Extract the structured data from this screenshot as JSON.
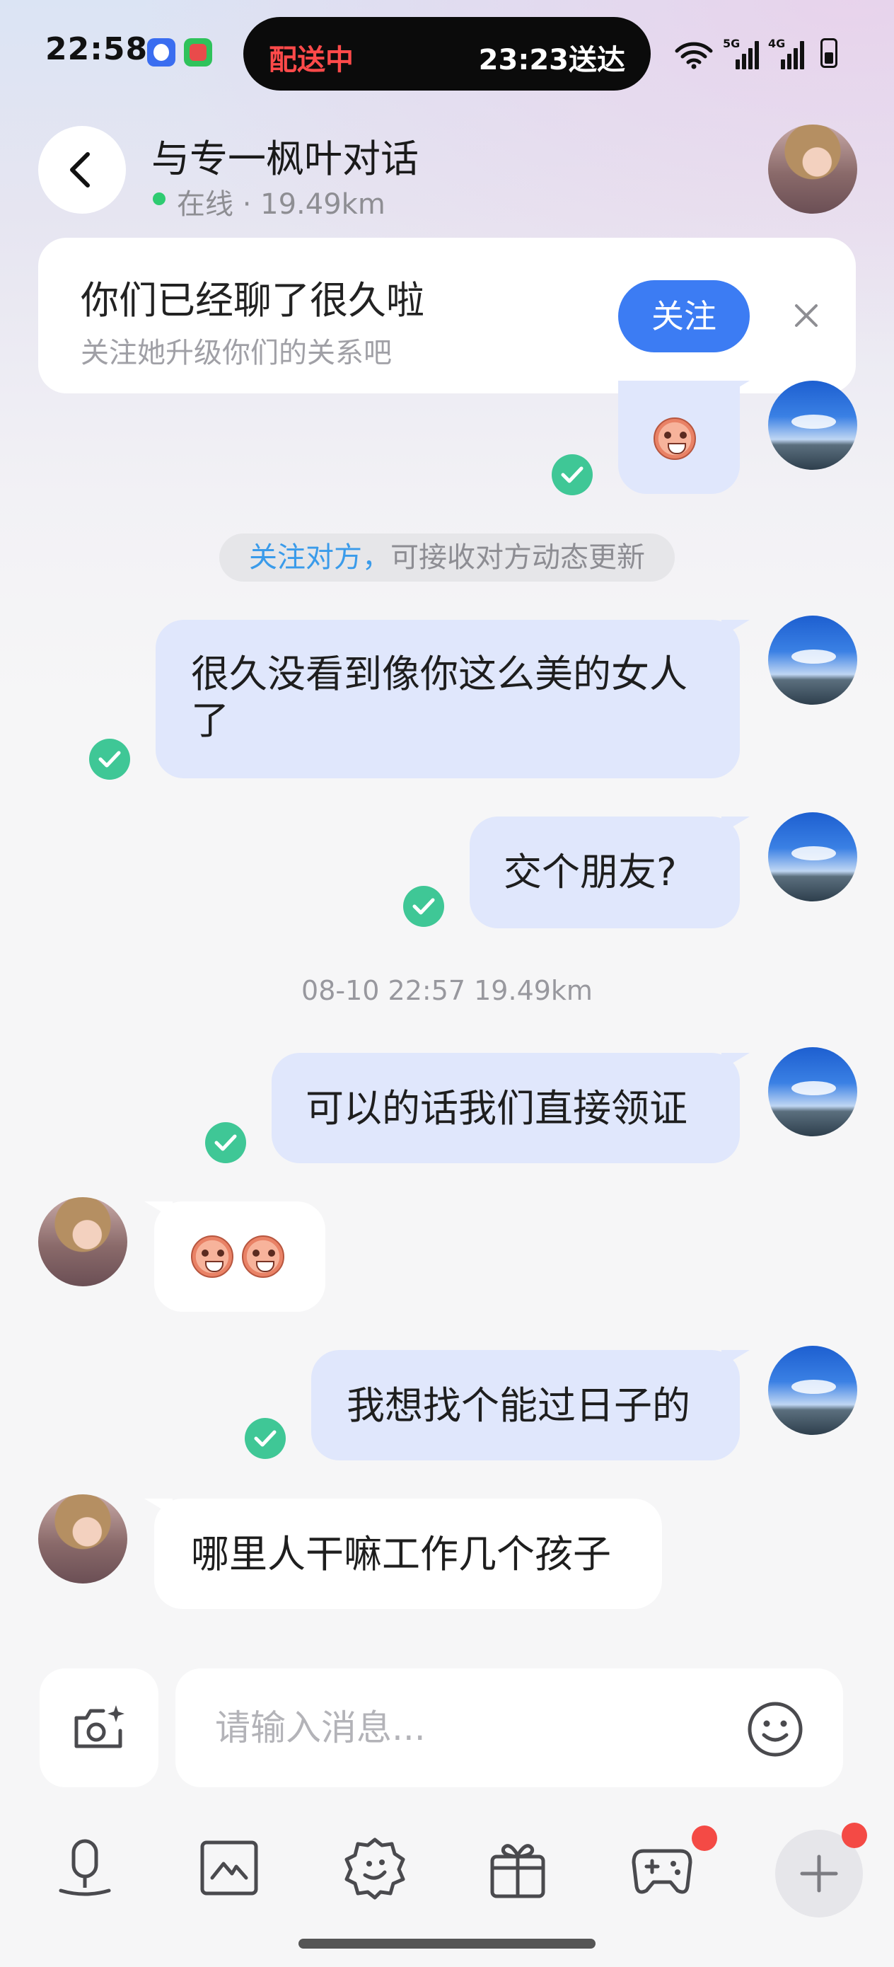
{
  "status_bar": {
    "time": "22:58",
    "delivery_status": "配送中",
    "delivery_eta": "23:23送达",
    "network_labels": [
      "5G",
      "4G"
    ],
    "icons": [
      "qq-icon",
      "app-icon",
      "wifi-icon",
      "signal-icon",
      "battery-icon"
    ]
  },
  "header": {
    "title": "与专一枫叶对话",
    "status": "在线",
    "distance": " · 19.49km",
    "back_icon": "chevron-left-icon"
  },
  "follow_card": {
    "title": "你们已经聊了很久啦",
    "subtitle": "关注她升级你们的关系吧",
    "follow_label": "关注",
    "close_icon": "close-icon"
  },
  "notice": {
    "link_text": "关注对方，",
    "rest_text": "可接收对方动态更新"
  },
  "timestamp": "08-10 22:57  19.49km",
  "messages": [
    {
      "side": "sent",
      "type": "emoji",
      "text": ""
    },
    {
      "side": "sent",
      "type": "text",
      "text": "很久没看到像你这么美的女人了"
    },
    {
      "side": "sent",
      "type": "text",
      "text": "交个朋友?"
    },
    {
      "side": "sent",
      "type": "text",
      "text": "可以的话我们直接领证"
    },
    {
      "side": "received",
      "type": "emoji",
      "text": ""
    },
    {
      "side": "sent",
      "type": "text",
      "text": "我想找个能过日子的"
    },
    {
      "side": "received",
      "type": "text",
      "text": "哪里人干嘛工作几个孩子"
    }
  ],
  "input": {
    "placeholder": "请输入消息...",
    "value": ""
  },
  "toolbar": {
    "items": [
      "voice-icon",
      "image-icon",
      "sticker-icon",
      "gift-icon",
      "game-icon",
      "plus-icon"
    ]
  },
  "colors": {
    "accent": "#3c7cf3",
    "sent_bubble": "#e0e7fc",
    "check": "#3fc796",
    "badge": "#f44a45"
  }
}
